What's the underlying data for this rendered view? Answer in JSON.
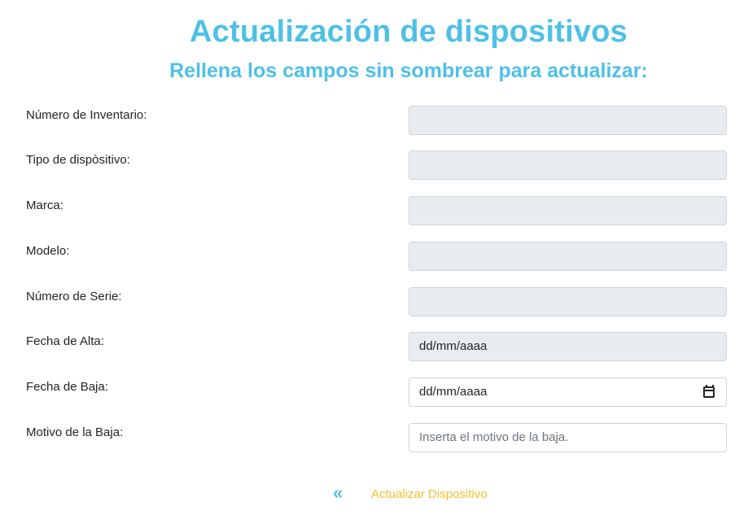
{
  "page": {
    "title": "Actualización de dispositivos",
    "subtitle": "Rellena los campos sin sombrear para actualizar:"
  },
  "form": {
    "fields": [
      {
        "label": "Número de Inventario:",
        "value": "",
        "state": "disabled"
      },
      {
        "label": "Tipo de dispòsitivo:",
        "value": "",
        "state": "disabled"
      },
      {
        "label": "Marca:",
        "value": "",
        "state": "disabled"
      },
      {
        "label": "Modelo:",
        "value": "",
        "state": "disabled"
      },
      {
        "label": "Número de Serie:",
        "value": "",
        "state": "disabled"
      },
      {
        "label": "Fecha de Alta:",
        "value": "dd/mm/aaaa",
        "state": "disabled"
      },
      {
        "label": "Fecha de Baja:",
        "value": "dd/mm/aaaa",
        "state": "enabled",
        "icon": "calendar-icon"
      },
      {
        "label": "Motivo de la Baja:",
        "placeholder": "Inserta el motivo de la baja.",
        "state": "enabled"
      }
    ]
  },
  "actions": {
    "back_icon": "«",
    "update_label": "Actualizar Dispositivo"
  },
  "colors": {
    "accent": "#4ec0e8",
    "link": "#f2c12e",
    "disabled_bg": "#e9ecef",
    "border": "#ced4da"
  }
}
